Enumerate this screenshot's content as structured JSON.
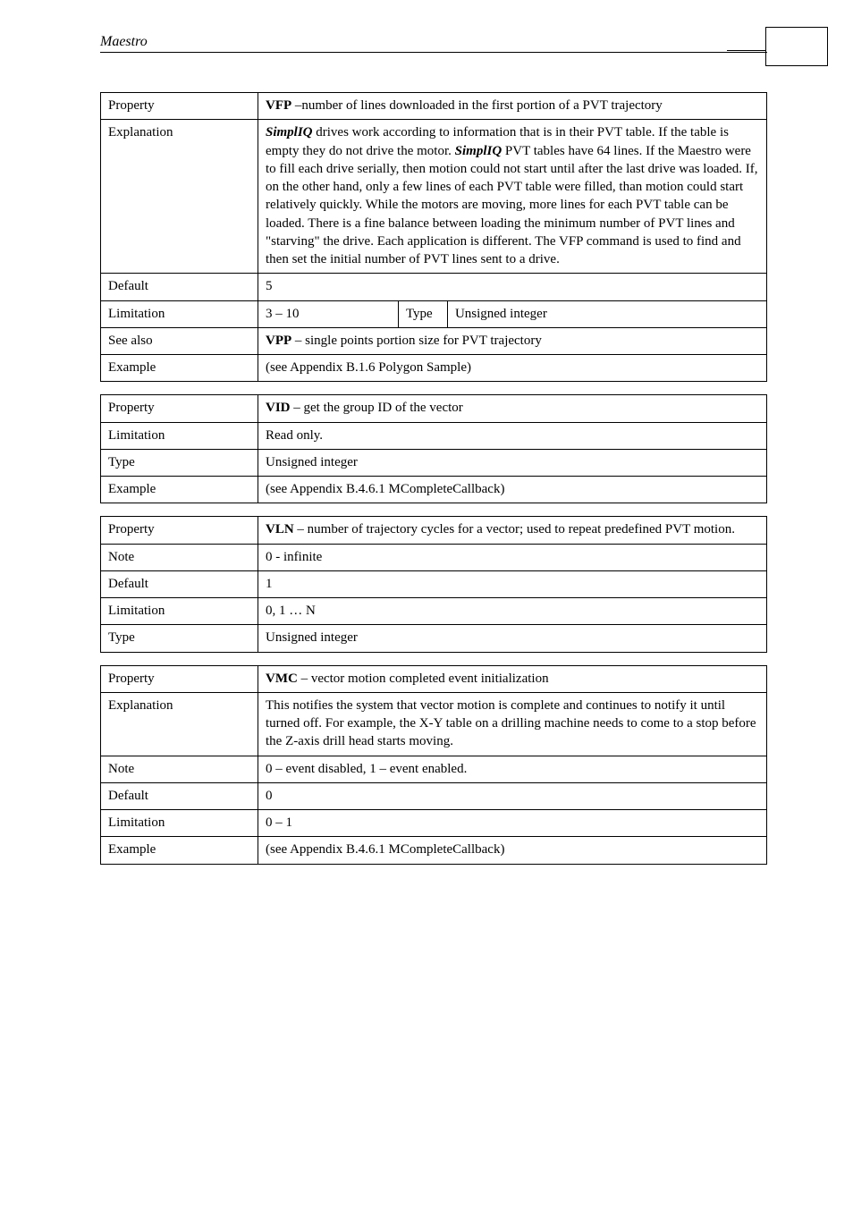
{
  "header": {
    "title": "Maestro"
  },
  "t1": {
    "r1": {
      "label": "Property",
      "prefix": "VFP",
      "suffix": " –number of lines downloaded in the first  portion of a PVT trajectory"
    },
    "r2": {
      "label": "Explanation",
      "p_a": "SimplIQ",
      "p_b": " drives work according to information that is in their PVT table. If the table is empty they do not drive the motor. ",
      "p_c": "SimplIQ",
      "p_d": " PVT tables have 64 lines. If the Maestro were to fill each drive serially, then motion could not start until after the last drive was loaded. If, on the other hand, only a few lines of each PVT table were filled, than motion could start relatively quickly. While the motors are moving, more lines for each PVT table can be loaded. There is a fine balance between loading the minimum number of PVT lines and \"starving\" the drive. Each application is different. The VFP command is used to find and then set the initial number of PVT lines sent to a drive."
    },
    "r3": {
      "label": "Default",
      "val": "5"
    },
    "r4": {
      "label": "Limitation",
      "val": "3 – 10",
      "type_lbl": "Type",
      "type_val": "Unsigned integer"
    },
    "r5": {
      "label": "See also",
      "prefix": "VPP",
      "suffix": " – single points portion size for PVT trajectory"
    },
    "r6": {
      "label": "Example",
      "val": "(see Appendix B.1.6 Polygon Sample)"
    }
  },
  "t2": {
    "r1": {
      "label": "Property",
      "prefix": "VID",
      "suffix": " – get the group ID of the vector"
    },
    "r2": {
      "label": "Limitation",
      "val": "Read only."
    },
    "r3": {
      "label": "Type",
      "val": "Unsigned integer"
    },
    "r4": {
      "label": "Example",
      "val": "(see Appendix B.4.6.1 MCompleteCallback)"
    }
  },
  "t3": {
    "r1": {
      "label": "Property",
      "prefix": "VLN",
      "suffix": " – number of trajectory cycles for a vector; used to repeat predefined PVT motion."
    },
    "r2": {
      "label": "Note",
      "val": "0 - infinite"
    },
    "r3": {
      "label": "Default",
      "val": "1"
    },
    "r4": {
      "label": "Limitation",
      "val": "0, 1 … N"
    },
    "r5": {
      "label": "Type",
      "val": "Unsigned integer"
    }
  },
  "t4": {
    "r1": {
      "label": "Property",
      "prefix": "VMC",
      "suffix": " – vector motion completed event initialization"
    },
    "r2": {
      "label": "Explanation",
      "val": "This notifies the system that vector motion is complete and continues to notify it until turned off. For example, the X-Y table on a drilling machine needs to come to a stop before the Z-axis drill head starts moving."
    },
    "r3": {
      "label": "Note",
      "val": "0 – event disabled, 1 – event enabled."
    },
    "r4": {
      "label": "Default",
      "val": "0"
    },
    "r5": {
      "label": "Limitation",
      "val": "0 – 1"
    },
    "r6": {
      "label": "Example",
      "val": "(see Appendix B.4.6.1 MCompleteCallback)"
    }
  }
}
